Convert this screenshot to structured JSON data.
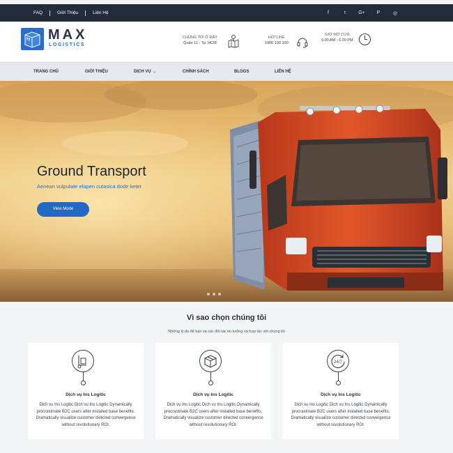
{
  "topbar": {
    "links": [
      "FAQ",
      "Giới Thiệu",
      "Liên Hệ"
    ],
    "social": [
      {
        "icon": "facebook-icon",
        "glyph": "f"
      },
      {
        "icon": "twitter-icon",
        "glyph": "t"
      },
      {
        "icon": "google-plus-icon",
        "glyph": "G+"
      },
      {
        "icon": "pinterest-icon",
        "glyph": "P"
      },
      {
        "icon": "instagram-icon",
        "glyph": "◎"
      }
    ]
  },
  "header": {
    "logo_main": "MAX",
    "logo_sub": "LOGISTICS",
    "location_title": "CHÚNG TÔI Ở ĐÂY",
    "location_value": "Quận 11 - Tp. HCM",
    "hotline_title": "HOTLINE",
    "hotline_value": "1900 100 100",
    "hours_title": "GIỜ MỞ CỬA",
    "hours_value": "9.00 AM - 6.00 PM"
  },
  "nav": {
    "items": [
      "TRANG CHỦ",
      "GIỚI THIỆU",
      "DỊCH VỤ",
      "CHÍNH SÁCH",
      "BLOGS",
      "LIÊN HỆ"
    ]
  },
  "hero": {
    "title": "Ground Transport",
    "subtitle": "Aenean vulputate elapen cutasica dode keter",
    "button": "View Mode"
  },
  "why": {
    "title": "Vì sao chọn chúng tôi",
    "subtitle": "Những lý do để bạn và các đối tác tin tưởng và hợp tác với chúng tôi",
    "cards": [
      {
        "icon": "hand-truck-icon",
        "title": "Dịch vụ Ins Logitic",
        "desc": "Dịch vụ Ins Logitic Dịch vụ Ins Logitic Dynamically procrastinate B2C users after installed base benefits. Dramatically visualize customer directed convergence without revolutionary ROI."
      },
      {
        "icon": "package-box-icon",
        "title": "Dịch vụ Ins Logitic",
        "desc": "Dịch vụ Ins Logitic Dịch vụ Ins Logitic Dynamically procrastinate B2C users after installed base benefits. Dramatically visualize customer directed convergence without revolutionary ROI."
      },
      {
        "icon": "24-7-support-icon",
        "title": "Dịch vụ Ins Logitic",
        "desc": "Dịch vụ Ins Logitic Dịch vụ Ins Logitic Dynamically procrastinate B2C users after installed base benefits. Dramatically visualize customer directed convergence without revolutionary ROI."
      }
    ]
  },
  "colors": {
    "topbar": "#232a3a",
    "brand_blue": "#2b6ec9",
    "nav_bg": "#e6eaef",
    "truck_red": "#d2491f"
  }
}
